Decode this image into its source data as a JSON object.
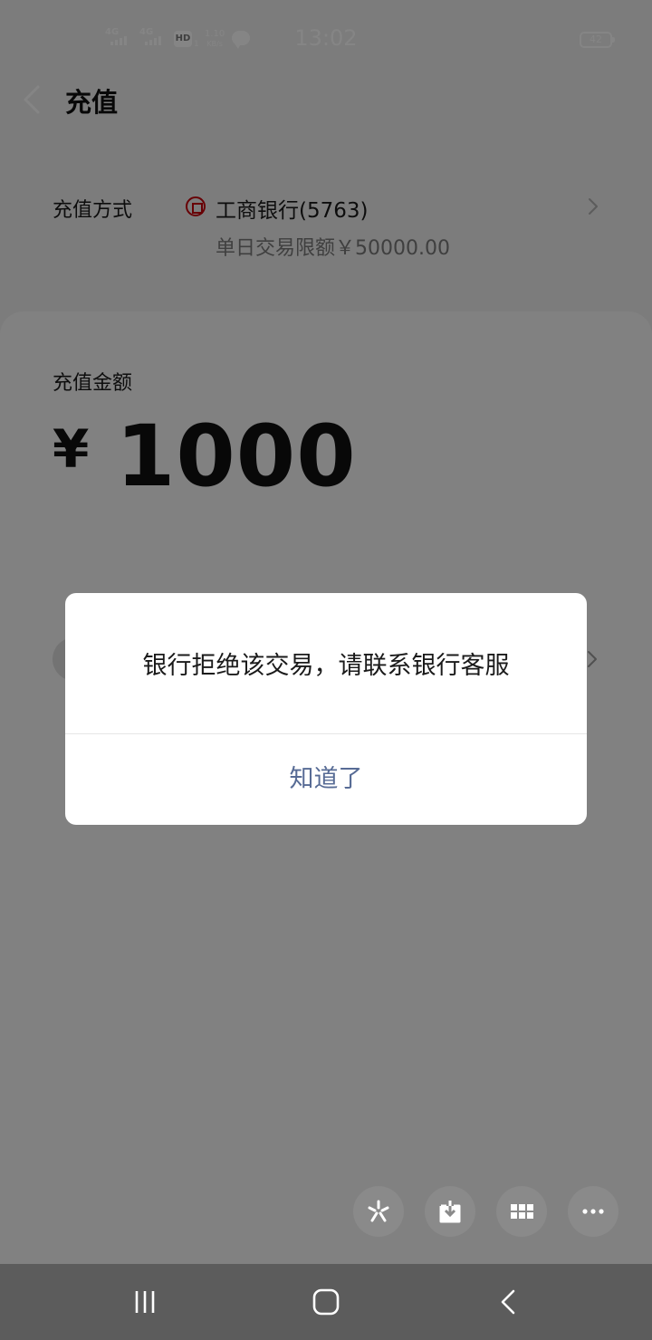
{
  "status_bar": {
    "network_1": "4G",
    "network_2": "4G",
    "hd": "HD",
    "hd_sub": "1",
    "speed_value": "1.10",
    "speed_unit": "KB/s",
    "time": "13:02",
    "battery": "42",
    "chat_icon": "chat-bubble-icon"
  },
  "header": {
    "title": "充值",
    "back_icon": "chevron-left-icon"
  },
  "payment_method": {
    "label": "充值方式",
    "bank_name": "工商银行(5763)",
    "limit": "单日交易限额￥50000.00",
    "bank_icon": "icbc-logo",
    "arrow_icon": "chevron-right-icon"
  },
  "amount": {
    "label": "充值金额",
    "currency": "¥",
    "value": "1000"
  },
  "dialog": {
    "message": "银行拒绝该交易，请联系银行客服",
    "button": "知道了",
    "button_color": "#576b95"
  },
  "floating_toolbar": [
    {
      "icon": "sparkle-icon"
    },
    {
      "icon": "download-icon"
    },
    {
      "icon": "grid-icon"
    },
    {
      "icon": "more-icon"
    }
  ],
  "system_nav": [
    {
      "icon": "recents-icon"
    },
    {
      "icon": "home-icon"
    },
    {
      "icon": "back-icon"
    }
  ]
}
